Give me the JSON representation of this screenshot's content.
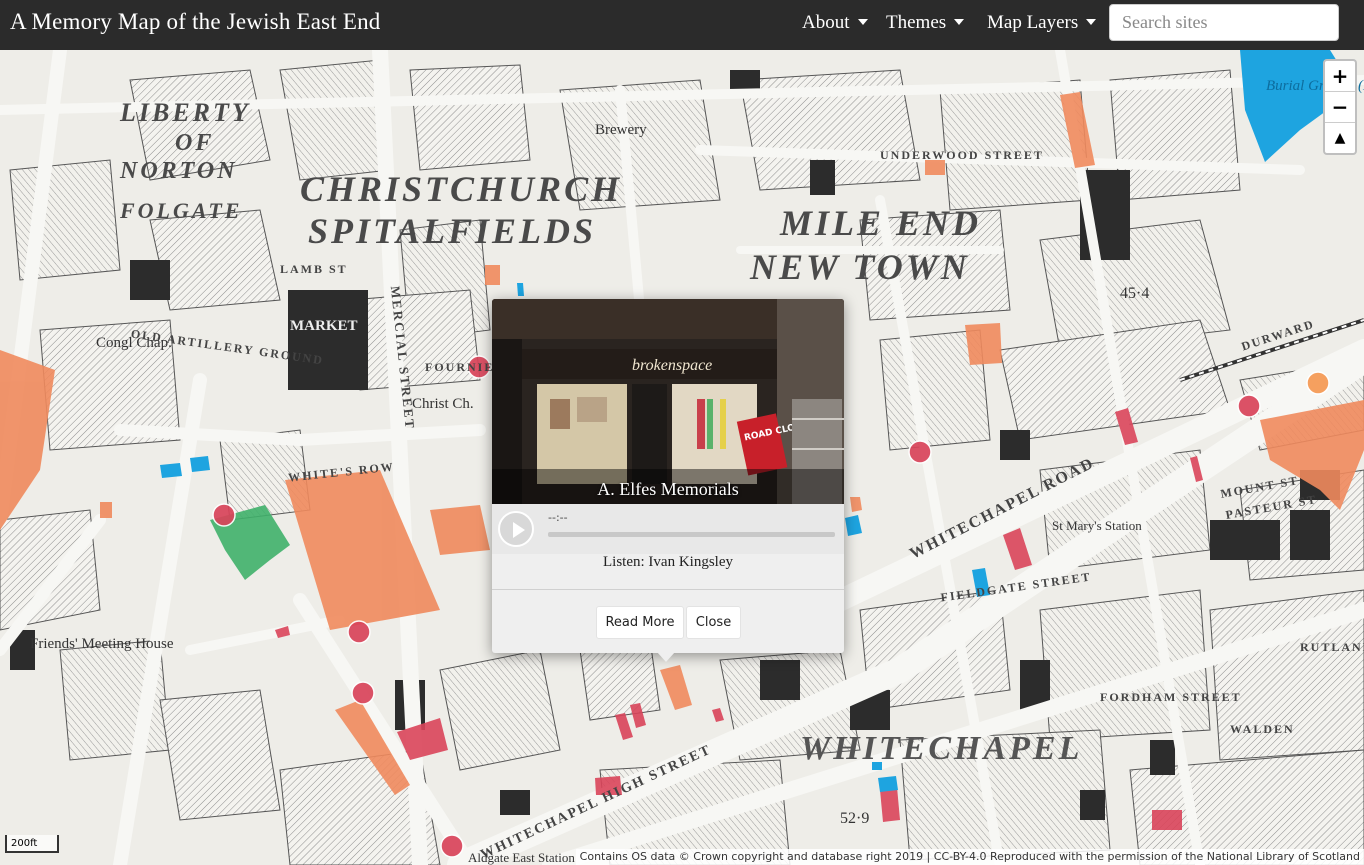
{
  "navbar": {
    "title": "A Memory Map of the Jewish East End",
    "menu": {
      "about": "About",
      "themes": "Themes",
      "map_layers": "Map Layers"
    },
    "search_placeholder": "Search sites"
  },
  "map": {
    "districts": [
      "CHRISTCHURCH",
      "SPITALFIELDS",
      "MILE END",
      "NEW TOWN",
      "LIBERTY",
      "OF",
      "NORTON",
      "FOLGATE",
      "WHITECHAPEL"
    ],
    "labels": {
      "market": "MARKET",
      "whitechapel_road": "WHITECHAPEL ROAD",
      "high_street": "WHITECHAPEL HIGH STREET",
      "commercial": "MERCIAL STREET",
      "christ_ch": "Christ Ch.",
      "congl_chap": "Congl Chap.",
      "old_artillery": "OLD ARTILLERY GROUND",
      "friends": "Friends' Meeting House",
      "burial": "Burial Ground (Disused)",
      "stmarys": "St Mary's Station",
      "brewery": "Brewery",
      "aldgate": "Aldgate East Station",
      "lamb": "LAMB ST",
      "white_row": "WHITE'S ROW",
      "fournier": "FOURNIER ST",
      "underwood": "UNDERWOOD STREET",
      "durward": "DURWARD",
      "fordham": "FORDHAM STREET",
      "walden": "WALDEN",
      "mount": "MOUNT ST",
      "pasteur": "PASTEUR ST",
      "fieldgate": "FIELDGATE STREET",
      "rutland": "RUTLAND",
      "spot_height_1": "45·4",
      "spot_height_2": "52·9"
    },
    "zoom": {
      "in": "+",
      "out": "−",
      "north": "▲"
    },
    "scale": "200ft",
    "attribution": "Contains OS data © Crown copyright and database right 2019 | CC-BY-4.0 Reproduced with the permission of the National Library of Scotland",
    "colors": {
      "orange": "#f08a5d",
      "red": "#d9445a",
      "green": "#3fb06a",
      "blue": "#1ea4e0"
    }
  },
  "popup": {
    "title": "A. Elfes Memorials",
    "time": "--:--",
    "listen": "Listen: Ivan Kingsley",
    "read_more": "Read More",
    "close": "Close",
    "shop_sign": "ROAD CLOSED",
    "shop_name": "brokenspace"
  }
}
